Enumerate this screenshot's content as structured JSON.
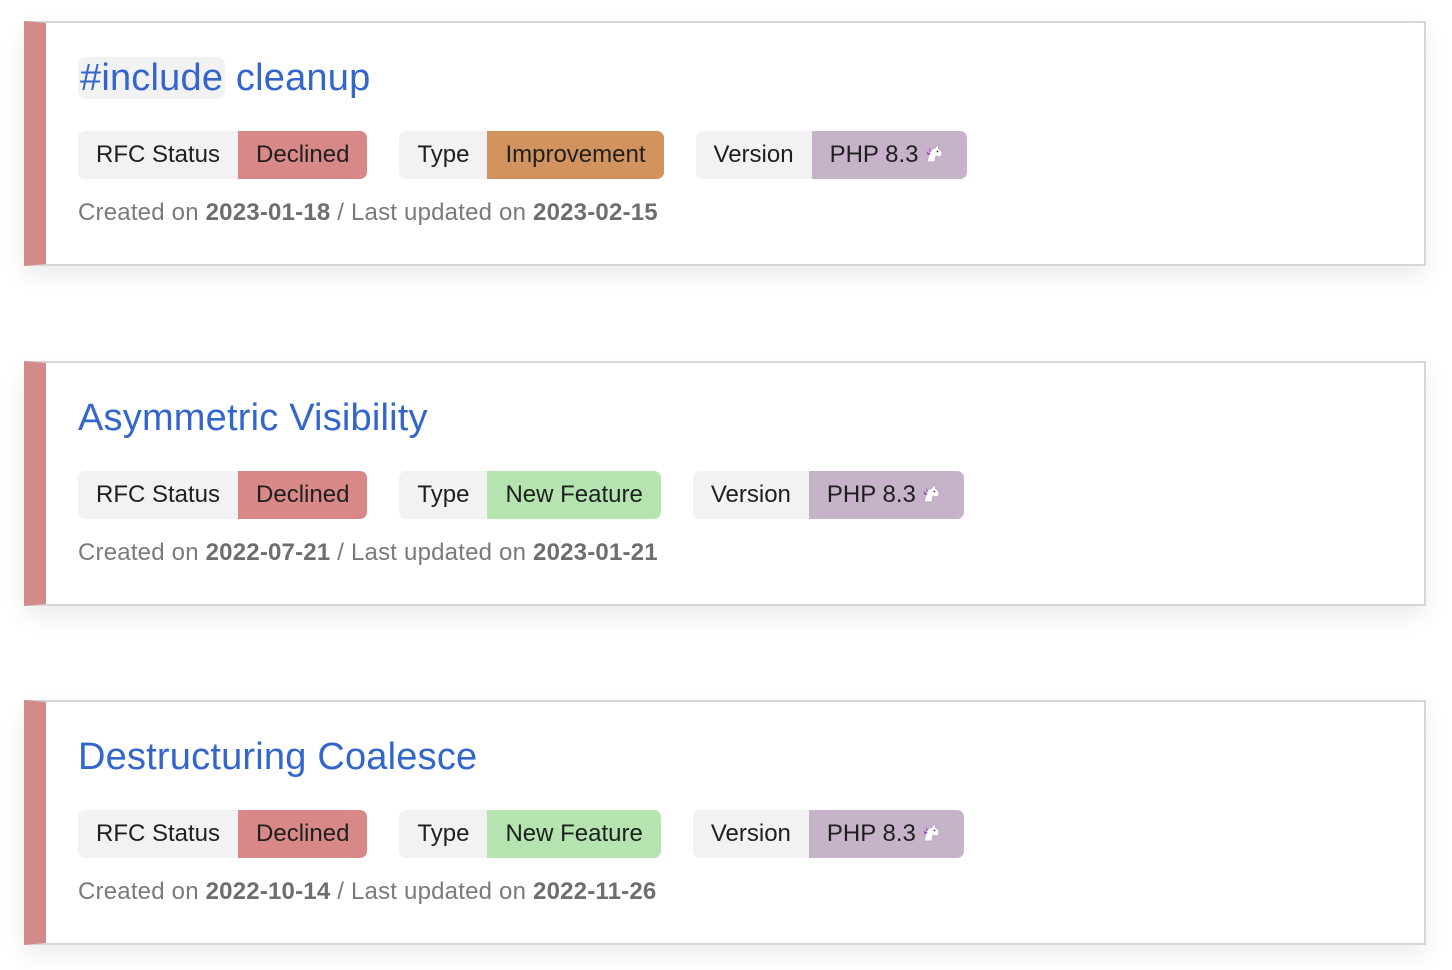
{
  "labels": {
    "status_key": "RFC Status",
    "type_key": "Type",
    "version_key": "Version",
    "created_prefix": "Created on",
    "updated_prefix": "/ Last updated on"
  },
  "colors": {
    "accent_bar": "#d38b89",
    "link": "#3366cc",
    "declined": "#d78887",
    "improvement": "#d2935f",
    "new_feature": "#b5e4b1",
    "version": "#c6b3c9"
  },
  "rfcs": [
    {
      "title_code": "#include",
      "title_rest": " cleanup",
      "status": "Declined",
      "type": "Improvement",
      "version": "PHP 8.3",
      "version_icon": "unicorn-icon",
      "created": "2023-01-18",
      "updated": "2023-02-15"
    },
    {
      "title": "Asymmetric Visibility",
      "status": "Declined",
      "type": "New Feature",
      "version": "PHP 8.3",
      "version_icon": "unicorn-icon",
      "created": "2022-07-21",
      "updated": "2023-01-21"
    },
    {
      "title": "Destructuring Coalesce",
      "status": "Declined",
      "type": "New Feature",
      "version": "PHP 8.3",
      "version_icon": "unicorn-icon",
      "created": "2022-10-14",
      "updated": "2022-11-26"
    }
  ]
}
